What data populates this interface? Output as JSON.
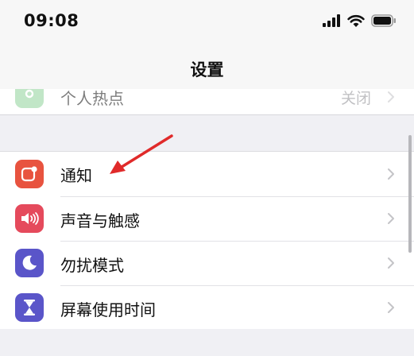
{
  "status_bar": {
    "time": "09:08",
    "icons": [
      "cellular-signal-icon",
      "wifi-icon",
      "battery-icon"
    ]
  },
  "nav": {
    "title": "设置"
  },
  "partial_row": {
    "label": "个人热点",
    "value": "关闭",
    "icon": "hotspot-icon",
    "icon_color": "#8fd39a"
  },
  "settings_group": {
    "items": [
      {
        "label": "通知",
        "icon": "notifications-icon",
        "icon_color": "#e8533f"
      },
      {
        "label": "声音与触感",
        "icon": "speaker-icon",
        "icon_color": "#e54a5c"
      },
      {
        "label": "勿扰模式",
        "icon": "moon-icon",
        "icon_color": "#5a55c9"
      },
      {
        "label": "屏幕使用时间",
        "icon": "hourglass-icon",
        "icon_color": "#5a55c9"
      }
    ]
  },
  "annotation": {
    "arrow_color": "#e02a2a",
    "points_to": "通知"
  }
}
